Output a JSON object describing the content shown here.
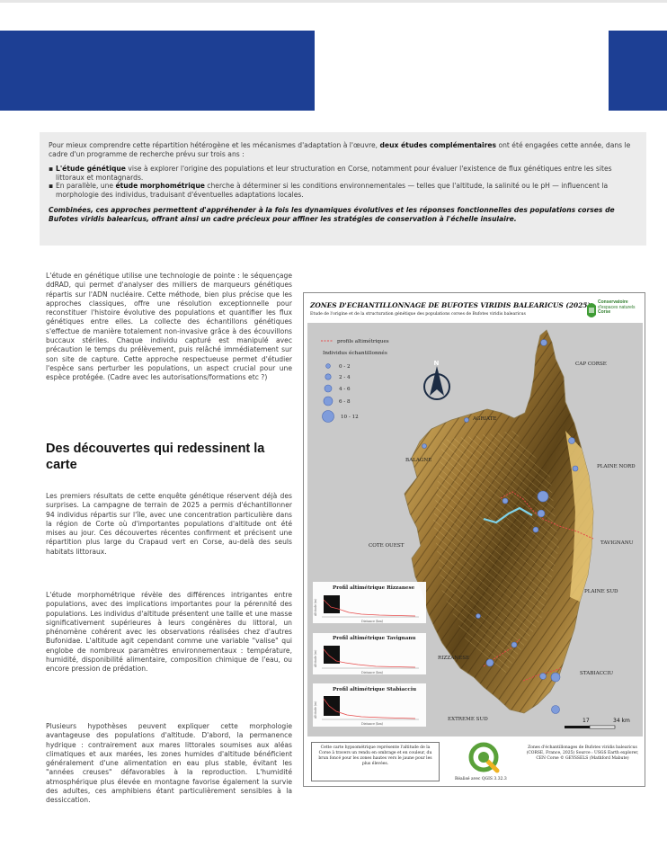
{
  "colors": {
    "band": "#1d3f94",
    "callout_bg": "#ececec",
    "sea": "#c9c9c9",
    "mountain": "#6e5322",
    "lowland": "#e3b860",
    "sample_point": "#7f9cdb",
    "river": "#7fd3ea",
    "profile": "#e64a4a"
  },
  "callout": {
    "intro_before": "Pour mieux comprendre cette répartition hétérogène et les mécanismes d'adaptation à l'œuvre, ",
    "intro_bold": "deux études complémentaires",
    "intro_after": " ont été engagées cette année, dans le cadre d'un programme de recherche prévu sur trois ans :",
    "bullets": [
      {
        "before": "",
        "bold": "L'étude génétique",
        "after": " vise à explorer l'origine des populations et leur structuration en Corse, notamment pour évaluer l'existence de flux génétiques entre les sites littoraux et montagnards."
      },
      {
        "before": "En parallèle, une ",
        "bold": "étude morphométrique",
        "after": " cherche à déterminer si les conditions environnementales — telles que l'altitude, la salinité ou le pH — influencent la morphologie des individus, traduisant d'éventuelles adaptations locales."
      }
    ],
    "closing": "Combinées, ces approches permettent d'appréhender à la fois les dynamiques évolutives et les réponses fonctionnelles des populations corses de Bufotes viridis balearicus, offrant ainsi un cadre précieux pour affiner les stratégies de conservation à l'échelle insulaire."
  },
  "article": {
    "para1": "L'étude en génétique utilise une technologie de pointe : le séquençage ddRAD, qui permet d'analyser des milliers de marqueurs génétiques répartis sur l'ADN nucléaire. Cette méthode, bien plus précise que les approches classiques, offre une résolution exceptionnelle pour reconstituer l'histoire évolutive des populations et quantifier les flux génétiques entre elles. La collecte des échantillons génétiques s'effectue de manière totalement non-invasive grâce à des écouvillons buccaux stériles. Chaque individu capturé est manipulé avec précaution le temps du prélèvement, puis relâché immédiatement sur son site de capture. Cette approche respectueuse permet d'étudier l'espèce sans perturber les populations, un aspect crucial pour une espèce protégée. (Cadre avec les autorisations/formations etc ?)",
    "heading": "Des découvertes qui redessinent la carte",
    "para2": "Les premiers résultats de cette enquête génétique réservent déjà des surprises. La campagne de terrain de 2025 a permis d'échantillonner 94 individus répartis sur l'île, avec une concentration particulière dans la région de Corte où d'importantes populations d'altitude ont été mises au jour. Ces découvertes récentes confirment et précisent une répartition plus large du Crapaud vert en Corse, au-delà des seuls habitats littoraux.",
    "para3": "L'étude morphométrique révèle des différences intrigantes entre populations, avec des implications importantes pour la pérennité des populations. Les individus d'altitude présentent une taille et une masse significativement supérieures à leurs congénères du littoral, un phénomène cohérent avec les observations réalisées chez d'autres Bufonidae. L'altitude agit cependant comme une variable \"valise\" qui englobe de nombreux paramètres environnementaux : température, humidité, disponibilité alimentaire, composition chimique de l'eau, ou encore pression de prédation.",
    "para4": "Plusieurs hypothèses peuvent expliquer cette morphologie avantageuse des populations d'altitude. D'abord, la permanence hydrique : contrairement aux mares littorales soumises aux aléas climatiques et aux marées, les zones humides d'altitude bénéficient généralement d'une alimentation en eau plus stable, évitant les \"années creuses\" défavorables à la reproduction. L'humidité atmosphérique plus élevée en montagne favorise également la survie des adultes, ces amphibiens étant particulièrement sensibles à la dessiccation."
  },
  "map": {
    "title": "ZONES D'ECHANTILLONNAGE DE BUFOTES VIRIDIS BALEARICUS (2025)",
    "subtitle": "Etude de l'origine et de la structuration génétique des populations corses de Bufotes viridis balearicus",
    "logo_lines": [
      "Conservatoire",
      "d'espaces naturels",
      "Corse"
    ],
    "legend_profile": "profils altimétriques",
    "legend_title": "Individus échantillonnés",
    "legend_classes": [
      "0 - 2",
      "2 - 4",
      "4 - 6",
      "6 - 8",
      "10 - 12"
    ],
    "north_label": "N",
    "regions": [
      "CAP CORSE",
      "AGRIATE",
      "BALAGNE",
      "PLAINE NORD",
      "COTE OUEST",
      "TAVIGNANU",
      "PLAINE SUD",
      "RIZZANESE",
      "STABIACCIU",
      "EXTREME SUD"
    ],
    "profiles": [
      {
        "title": "Profil altimétrique Rizzanese",
        "x_label": "Distance (km)",
        "y_label": "Altitude (m)"
      },
      {
        "title": "Profil altimétrique Tavignanu",
        "x_label": "Distance (km)",
        "y_label": "Altitude (m)"
      },
      {
        "title": "Profil altimétrique Stabiacciu",
        "x_label": "Distance (km)",
        "y_label": "Altitude (m)"
      }
    ],
    "scale_labels": [
      "17",
      "34 km"
    ],
    "description": "Cette carte hypsométrique représente l'altitude de la Corse à travers un rendu en ombrage et en couleur, du brun foncé pour les zones hautes vers le jaune pour les plus élevées.",
    "qgis_caption": "Réalisé avec QGIS 3.32.3",
    "credit": "Zones d'échantillonages de Bufotes viridis balearicus (CORSE, France, 2025) Source : USGS Earth explorer, CEN Corse © GEYSSELS (Mathford Mabute)"
  }
}
